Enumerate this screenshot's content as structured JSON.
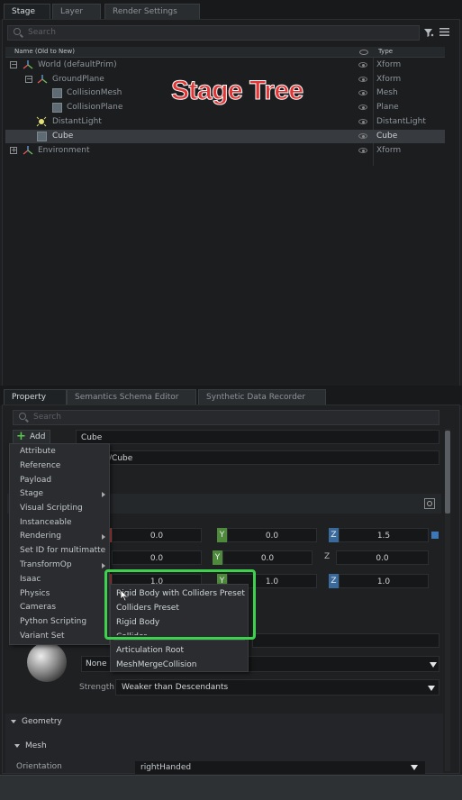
{
  "stage_panel": {
    "tabs": [
      "Stage",
      "Layer",
      "Render Settings"
    ],
    "search_placeholder": "Search",
    "col_name": "Name (Old to New)",
    "col_type": "Type",
    "overlay_label": "Stage Tree",
    "rows": [
      {
        "name": "World (defaultPrim)",
        "type": "Xform"
      },
      {
        "name": "GroundPlane",
        "type": "Xform"
      },
      {
        "name": "CollisionMesh",
        "type": "Mesh"
      },
      {
        "name": "CollisionPlane",
        "type": "Plane"
      },
      {
        "name": "DistantLight",
        "type": "DistantLight"
      },
      {
        "name": "Cube",
        "type": "Cube"
      },
      {
        "name": "Environment",
        "type": "Xform"
      }
    ]
  },
  "property_panel": {
    "tabs": [
      "Property",
      "Semantics Schema Editor",
      "Synthetic Data Recorder"
    ],
    "search_placeholder": "Search",
    "add_label": "Add",
    "prim_name": "Cube",
    "prim_path": "/Cube",
    "add_menu": [
      "Attribute",
      "Reference",
      "Payload",
      "Stage",
      "Visual Scripting",
      "Instanceable",
      "Rendering",
      "Set ID for multimatte",
      "TransformOp",
      "Isaac",
      "Physics",
      "Cameras",
      "Python Scripting",
      "Variant Set"
    ],
    "physics_submenu": [
      "Rigid Body with Colliders Preset",
      "Colliders Preset",
      "Rigid Body",
      "Collider",
      "Articulation Root",
      "MeshMergeCollision"
    ],
    "transform_rows": [
      {
        "x": "0.0",
        "y": "0.0",
        "z": "1.5"
      },
      {
        "x": "0.0",
        "y": "0.0",
        "z": "0.0"
      },
      {
        "x": "1.0",
        "y": "1.0",
        "z": "1.0"
      }
    ],
    "axis_labels": [
      "Y",
      "Z"
    ],
    "material_none": "None",
    "strength_label": "Strength",
    "strength_value": "Weaker than Descendants",
    "geometry_label": "Geometry",
    "mesh_label": "Mesh",
    "orientation_label": "Orientation",
    "orientation_value": "rightHanded"
  },
  "colors": {
    "highlight_green": "#3ed14e",
    "overlay_red": "#e23535",
    "axis_y": "#4f8a3c",
    "axis_z": "#3a6a9c"
  }
}
